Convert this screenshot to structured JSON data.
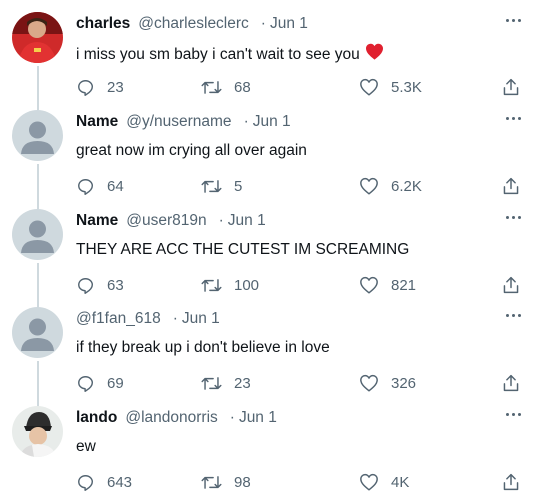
{
  "tweets": [
    {
      "display_name": "charles",
      "handle": "@charlesleclerc",
      "date": "Jun 1",
      "text": "i miss you sm baby i can't wait to see you",
      "emoji": "red-heart",
      "replies": "23",
      "retweets": "68",
      "likes": "5.3K",
      "avatar": "photo-red-shirt"
    },
    {
      "display_name": "Name",
      "handle": "@y/nusername",
      "date": "Jun 1",
      "text": "great now im crying all over again",
      "replies": "64",
      "retweets": "5",
      "likes": "6.2K",
      "avatar": "default"
    },
    {
      "display_name": "Name",
      "handle": "@user819n",
      "date": "Jun 1",
      "text": "THEY ARE ACC THE CUTEST IM SCREAMING",
      "replies": "63",
      "retweets": "100",
      "likes": "821",
      "avatar": "default"
    },
    {
      "display_name": "",
      "handle": "@f1fan_618",
      "date": "Jun 1",
      "text": "if they break up i don't believe in love",
      "replies": "69",
      "retweets": "23",
      "likes": "326",
      "avatar": "default"
    },
    {
      "display_name": "lando",
      "handle": "@landonorris",
      "date": "Jun 1",
      "text": "ew",
      "replies": "643",
      "retweets": "98",
      "likes": "4K",
      "avatar": "photo-beanie"
    }
  ],
  "colors": {
    "text": "#0f1419",
    "muted": "#536471",
    "thread_line": "#cfd9de",
    "heart": "#e0202f",
    "default_avatar_bg": "#cfd9de",
    "default_avatar_fg": "#8b98a5"
  }
}
